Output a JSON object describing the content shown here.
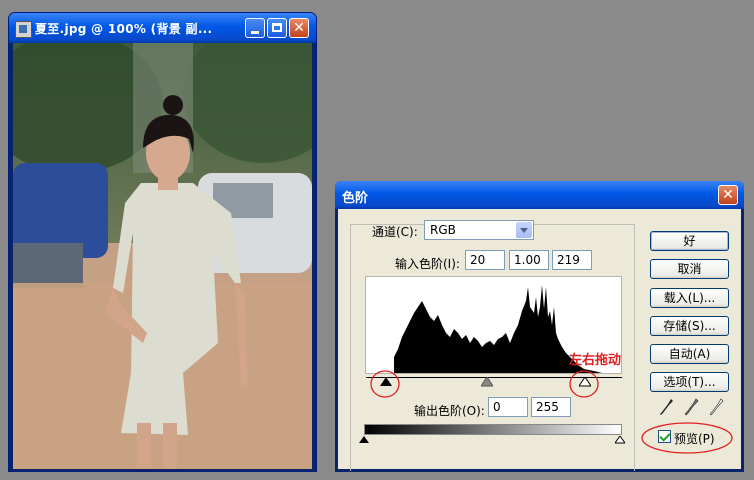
{
  "image_window": {
    "title": "夏至.jpg @ 100% (背景 副..."
  },
  "dialog": {
    "title": "色阶",
    "channel": {
      "label": "通道(C):",
      "value": "RGB"
    },
    "input_levels": {
      "label": "输入色阶(I):",
      "black": "20",
      "gamma": "1.00",
      "white": "219"
    },
    "output_levels": {
      "label": "输出色阶(O):",
      "black": "0",
      "white": "255"
    },
    "annotation": "左右拖动",
    "buttons": {
      "ok": "好",
      "cancel": "取消",
      "load": "载入(L)...",
      "save": "存储(S)...",
      "auto": "自动(A)",
      "options": "选项(T)..."
    },
    "preview": {
      "label": "预览(P)",
      "checked": true
    }
  },
  "colors": {
    "xp_title": "#0058e6",
    "dialog_bg": "#ece9d8",
    "annotation_red": "#e02020",
    "desktop": "#8a8a8a"
  }
}
